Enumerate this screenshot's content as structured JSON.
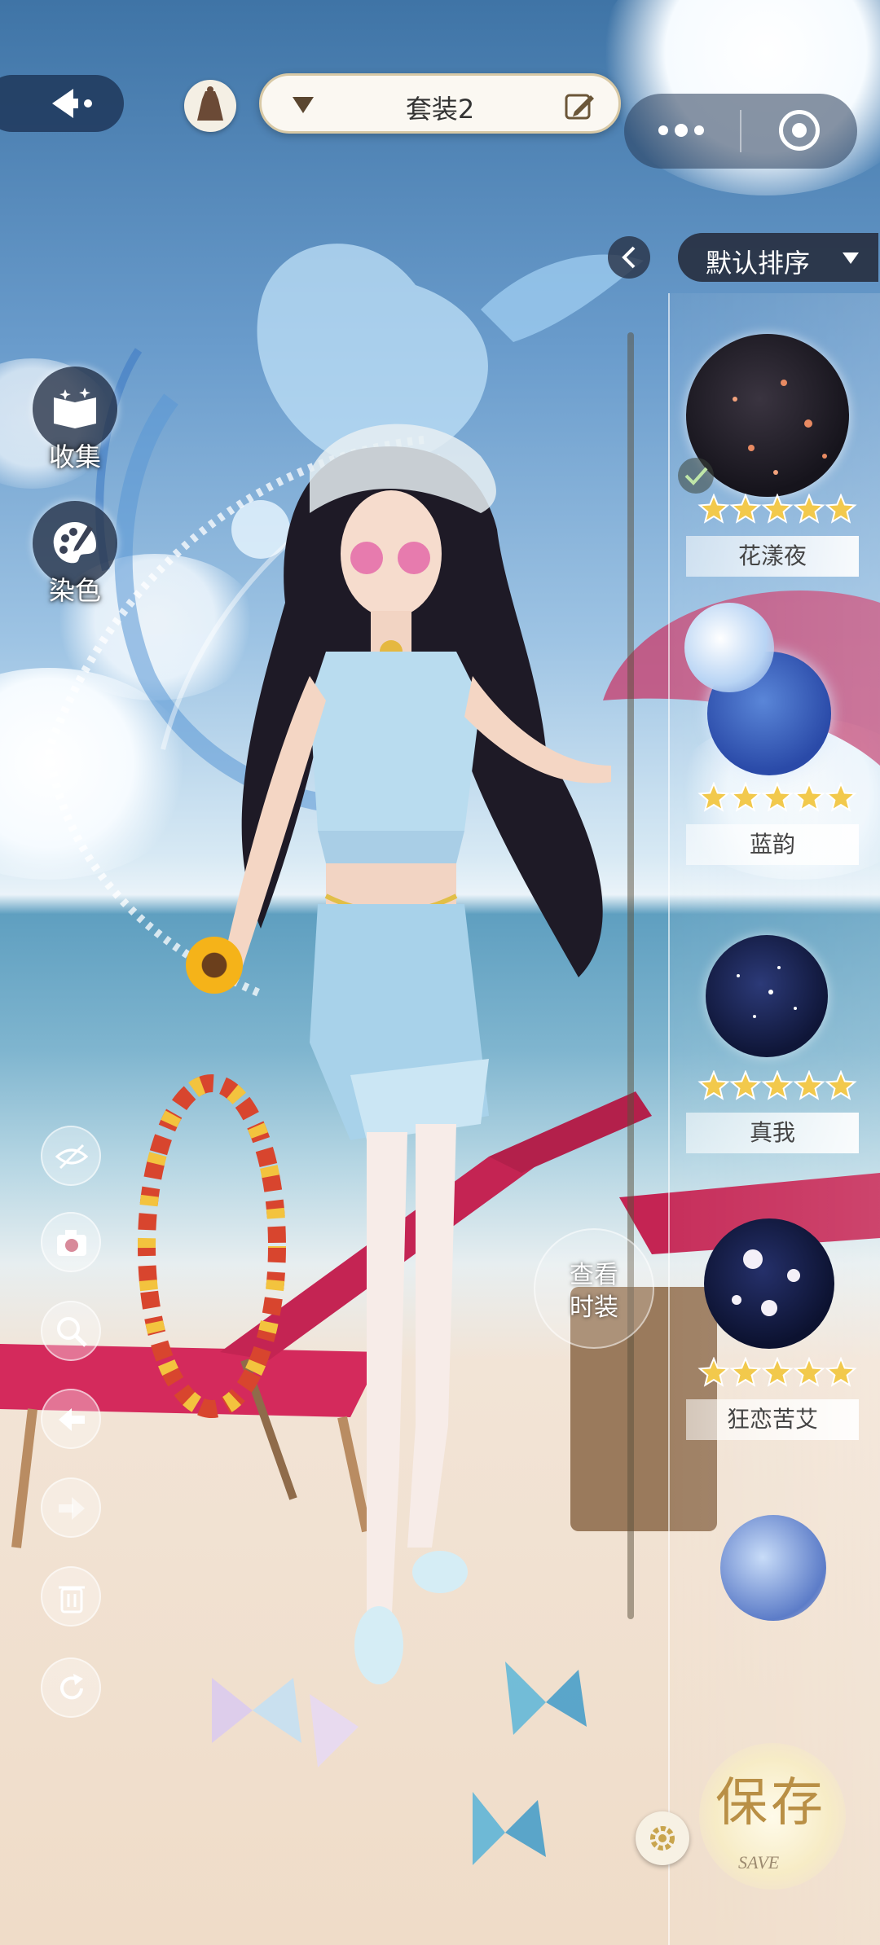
{
  "header": {
    "outfit_name": "套装2"
  },
  "sidebar": {
    "collect_label": "收集",
    "dye_label": "染色"
  },
  "sort": {
    "label": "默认排序"
  },
  "items": [
    {
      "name": "花漾夜",
      "stars": 5,
      "selected": true
    },
    {
      "name": "蓝韵",
      "stars": 5,
      "selected": false
    },
    {
      "name": "真我",
      "stars": 5,
      "selected": false
    },
    {
      "name": "狂恋苦艾",
      "stars": 5,
      "selected": false
    }
  ],
  "view_button": {
    "line1": "查看",
    "line2": "时装"
  },
  "save_button": {
    "label": "保存",
    "sub_label": "SAVE"
  },
  "colors": {
    "accent_gold": "#c9a54e",
    "star_gold": "#f2c94c",
    "panel_dark": "#23283a"
  }
}
